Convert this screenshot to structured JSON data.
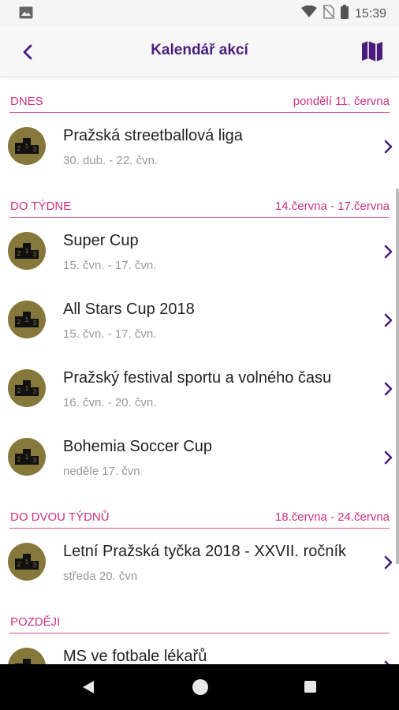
{
  "status_bar": {
    "time": "15:39",
    "icons": [
      "image-icon",
      "wifi-icon",
      "no-sim-icon",
      "battery-icon"
    ]
  },
  "app_bar": {
    "title": "Kalendář akcí",
    "back_icon": "chevron-left-icon",
    "map_icon": "map-icon"
  },
  "colors": {
    "accent": "#4a1c7d",
    "section": "#d0307f",
    "badge": "#85783a"
  },
  "sections": [
    {
      "label": "DNES",
      "range": "pondělí 11. června",
      "events": [
        {
          "name": "Pražská streetballová liga",
          "dates": "30. dub. - 22. čvn."
        }
      ]
    },
    {
      "label": "DO TÝDNE",
      "range": "14.června - 17.června",
      "events": [
        {
          "name": "Super Cup",
          "dates": "15. čvn. - 17. čvn."
        },
        {
          "name": "All Stars Cup 2018",
          "dates": "15. čvn. - 17. čvn."
        },
        {
          "name": "Pražský festival sportu a volného času",
          "dates": "16. čvn. - 20. čvn."
        },
        {
          "name": "Bohemia Soccer Cup",
          "dates": "neděle 17. čvn"
        }
      ]
    },
    {
      "label": "DO DVOU TÝDNŮ",
      "range": "18.června - 24.června",
      "events": [
        {
          "name": "Letní Pražská tyčka 2018 - XXVII. ročník",
          "dates": "středa 20. čvn"
        }
      ]
    },
    {
      "label": "POZDĚJI",
      "range": "",
      "events": [
        {
          "name": "MS ve fotbale lékařů",
          "dates": ""
        }
      ]
    }
  ],
  "nav_bar": {
    "icons": [
      "back-triangle-icon",
      "home-circle-icon",
      "recents-square-icon"
    ]
  }
}
